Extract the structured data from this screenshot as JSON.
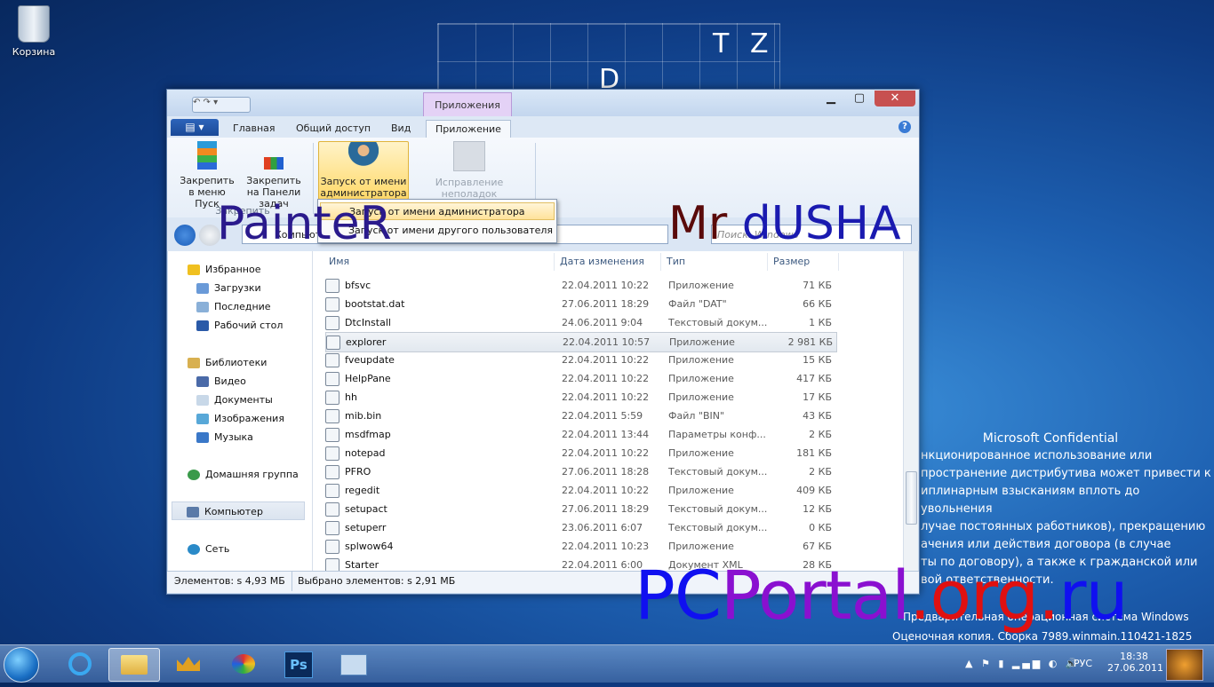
{
  "desktop": {
    "recycle_bin_label": "Корзина",
    "grid_letters": [
      "T",
      "Z",
      "D"
    ],
    "watermark": {
      "title": "Microsoft Confidential",
      "lines": [
        "нкционированное использование или",
        "пространение дистрибутива может привести к",
        "иплинарным взысканиям вплоть до увольнения",
        "лучае постоянных работников), прекращению",
        "ачения или действия договора (в случае",
        "ты по договору), а также к гражданской или",
        "вой ответственности."
      ],
      "edition": "Предварительная операционная система Windows",
      "build": "Оценочная копия. Сборка 7989.winmain.110421-1825"
    }
  },
  "window": {
    "context_group": "Приложения",
    "controls": {
      "minimize": "▁",
      "maximize": "▢",
      "close": "✕"
    },
    "qat": "↶ ↷ ▾",
    "tabs": {
      "file": "▤ ▾",
      "home": "Главная",
      "share": "Общий доступ",
      "view": "Вид",
      "app": "Приложение"
    },
    "help": "?",
    "ribbon": {
      "pin_start": "Закрепить в меню Пуск",
      "pin_taskbar": "Закрепить на Панели задач",
      "pin_group": "Закрепить",
      "run_as_admin": "Запуск от имени администратора ▾",
      "compat": "Исправление неполадок совместимости"
    },
    "menu": {
      "item1": "Запуск от имени администратора",
      "item2": "Запуск от имени другого пользователя"
    },
    "address": {
      "path": "Компьютер ▸ Локальный диск (C:) ▸ Windows ▸",
      "search_placeholder": "Поиск: Windows"
    },
    "nav": {
      "favorites": "Избранное",
      "downloads": "Загрузки",
      "recent": "Последние",
      "desktop": "Рабочий стол",
      "libraries": "Библиотеки",
      "video": "Видео",
      "documents": "Документы",
      "pictures": "Изображения",
      "music": "Музыка",
      "homegroup": "Домашняя группа",
      "computer": "Компьютер",
      "network": "Сеть"
    },
    "columns": {
      "name": "Имя",
      "date": "Дата изменения",
      "type": "Тип",
      "size": "Размер"
    },
    "files": [
      {
        "name": "bfsvc",
        "date": "22.04.2011 10:22",
        "type": "Приложение",
        "size": "71 КБ"
      },
      {
        "name": "bootstat.dat",
        "date": "27.06.2011 18:29",
        "type": "Файл \"DAT\"",
        "size": "66 КБ"
      },
      {
        "name": "DtcInstall",
        "date": "24.06.2011 9:04",
        "type": "Текстовый докум...",
        "size": "1 КБ"
      },
      {
        "name": "explorer",
        "date": "22.04.2011 10:57",
        "type": "Приложение",
        "size": "2 981 КБ"
      },
      {
        "name": "fveupdate",
        "date": "22.04.2011 10:22",
        "type": "Приложение",
        "size": "15 КБ"
      },
      {
        "name": "HelpPane",
        "date": "22.04.2011 10:22",
        "type": "Приложение",
        "size": "417 КБ"
      },
      {
        "name": "hh",
        "date": "22.04.2011 10:22",
        "type": "Приложение",
        "size": "17 КБ"
      },
      {
        "name": "mib.bin",
        "date": "22.04.2011 5:59",
        "type": "Файл \"BIN\"",
        "size": "43 КБ"
      },
      {
        "name": "msdfmap",
        "date": "22.04.2011 13:44",
        "type": "Параметры конф...",
        "size": "2 КБ"
      },
      {
        "name": "notepad",
        "date": "22.04.2011 10:22",
        "type": "Приложение",
        "size": "181 КБ"
      },
      {
        "name": "PFRO",
        "date": "27.06.2011 18:28",
        "type": "Текстовый докум...",
        "size": "2 КБ"
      },
      {
        "name": "regedit",
        "date": "22.04.2011 10:22",
        "type": "Приложение",
        "size": "409 КБ"
      },
      {
        "name": "setupact",
        "date": "27.06.2011 18:29",
        "type": "Текстовый докум...",
        "size": "12 КБ"
      },
      {
        "name": "setuperr",
        "date": "23.06.2011 6:07",
        "type": "Текстовый докум...",
        "size": "0 КБ"
      },
      {
        "name": "splwow64",
        "date": "22.04.2011 10:23",
        "type": "Приложение",
        "size": "67 КБ"
      },
      {
        "name": "Starter",
        "date": "22.04.2011 6:00",
        "type": "Документ XML",
        "size": "28 КБ"
      }
    ],
    "status": {
      "items": "Элементов: s  4,93 МБ",
      "selected": "Выбрано элементов: s  2,91 МБ"
    }
  },
  "overlays": {
    "painter": "PainteR",
    "mrdusha": "Mr dUSHA",
    "site": [
      "PC",
      "Portal",
      ".",
      "org",
      ".",
      "ru"
    ],
    "colors": {
      "painter": "#2a1a8c",
      "mr": "#5a0a0a",
      "dusha": "#1a1ab0",
      "pc": "#1010f0",
      "portal": "#8a10d0",
      "dot": "#e01010",
      "org": "#e01010",
      "ru": "#1010f0"
    }
  },
  "taskbar": {
    "ps_label": "Ps",
    "lang": "РУС",
    "time": "18:38",
    "date": "27.06.2011",
    "tray_icons": "▲ ⚑ ▮ ▂▄▆ ◐ 🔊"
  }
}
